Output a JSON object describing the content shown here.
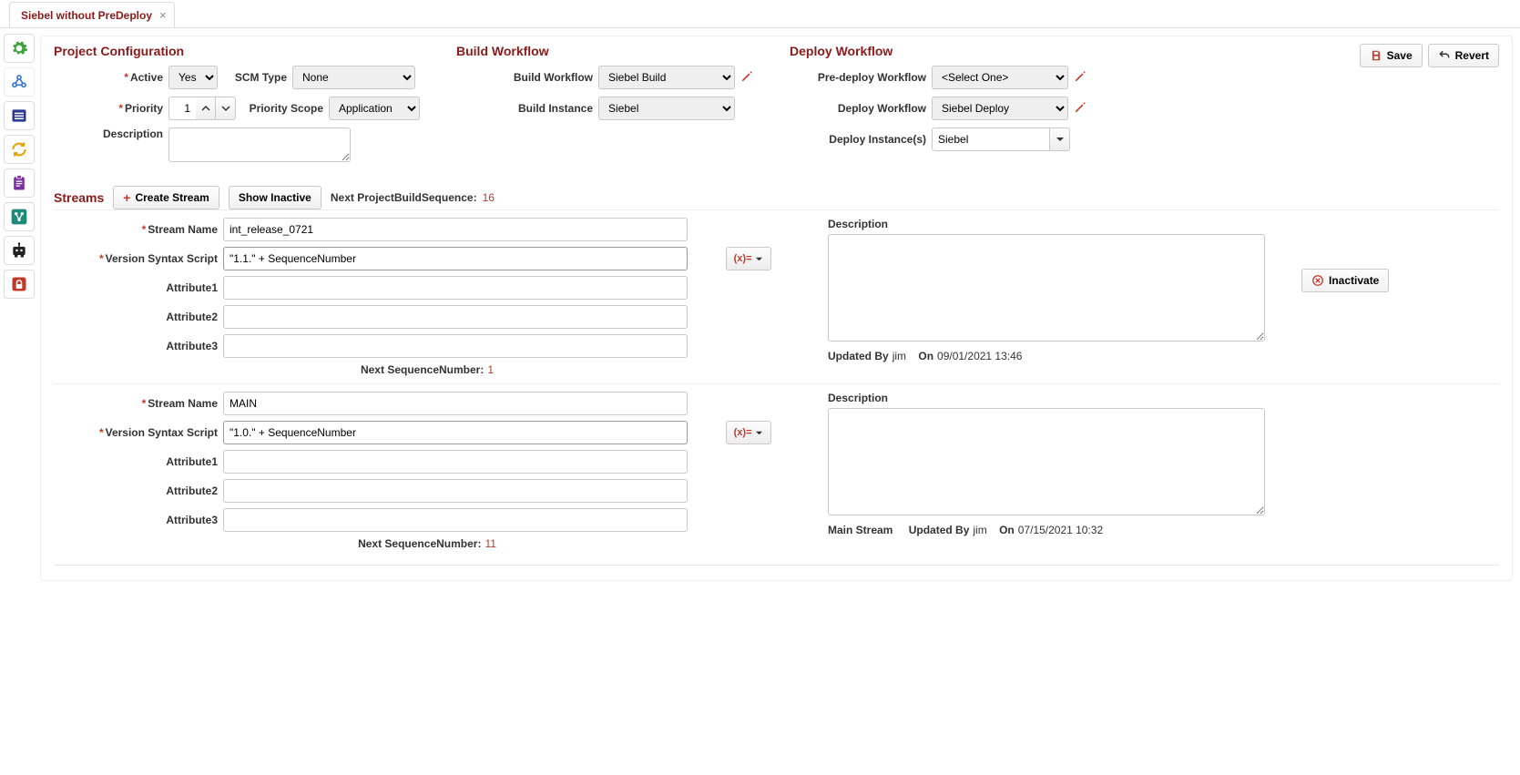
{
  "tab": {
    "title": "Siebel without PreDeploy"
  },
  "buttons": {
    "save": "Save",
    "revert": "Revert",
    "create_stream": "Create Stream",
    "show_inactive": "Show Inactive",
    "inactivate": "Inactivate"
  },
  "project_config": {
    "heading": "Project Configuration",
    "active_label": "Active",
    "active_value": "Yes",
    "scm_type_label": "SCM Type",
    "scm_type_value": "None",
    "priority_label": "Priority",
    "priority_value": "1",
    "priority_scope_label": "Priority Scope",
    "priority_scope_value": "Application",
    "description_label": "Description",
    "description_value": ""
  },
  "build_wf": {
    "heading": "Build Workflow",
    "workflow_label": "Build Workflow",
    "workflow_value": "Siebel Build",
    "instance_label": "Build Instance",
    "instance_value": "Siebel"
  },
  "deploy_wf": {
    "heading": "Deploy Workflow",
    "pre_label": "Pre-deploy Workflow",
    "pre_value": "<Select One>",
    "deploy_label": "Deploy Workflow",
    "deploy_value": "Siebel Deploy",
    "instances_label": "Deploy Instance(s)",
    "instances_value": "Siebel"
  },
  "streams_section": {
    "heading": "Streams",
    "next_build_seq_label": "Next ProjectBuildSequence:",
    "next_build_seq_value": "16"
  },
  "labels": {
    "stream_name": "Stream Name",
    "version_syntax_script": "Version Syntax Script",
    "attribute1": "Attribute1",
    "attribute2": "Attribute2",
    "attribute3": "Attribute3",
    "next_seq": "Next SequenceNumber:",
    "description": "Description",
    "updated_by": "Updated By",
    "on": "On",
    "main_stream": "Main Stream"
  },
  "streams": [
    {
      "name": "int_release_0721",
      "version_script": "\"1.1.\" + SequenceNumber",
      "attr1": "",
      "attr2": "",
      "attr3": "",
      "next_seq": "1",
      "description": "",
      "updated_by": "jim",
      "updated_on": "09/01/2021 13:46",
      "is_main": false
    },
    {
      "name": "MAIN",
      "version_script": "\"1.0.\" + SequenceNumber",
      "attr1": "",
      "attr2": "",
      "attr3": "",
      "next_seq": "11",
      "description": "",
      "updated_by": "jim",
      "updated_on": "07/15/2021 10:32",
      "is_main": true
    }
  ]
}
